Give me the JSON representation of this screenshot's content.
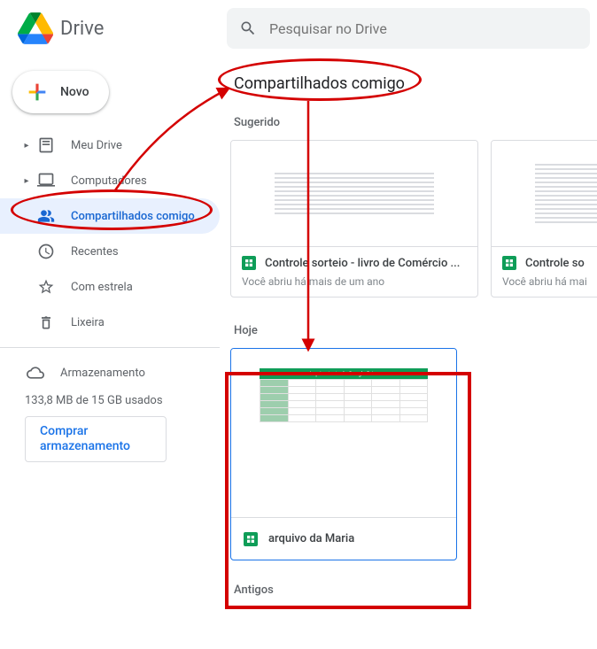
{
  "header": {
    "app_name": "Drive",
    "search_placeholder": "Pesquisar no Drive"
  },
  "sidebar": {
    "new_label": "Novo",
    "items": [
      {
        "label": "Meu Drive",
        "icon": "my-drive",
        "has_caret": true
      },
      {
        "label": "Computadores",
        "icon": "computers",
        "has_caret": true
      },
      {
        "label": "Compartilhados comigo",
        "icon": "shared",
        "active": true
      },
      {
        "label": "Recentes",
        "icon": "recent"
      },
      {
        "label": "Com estrela",
        "icon": "starred"
      },
      {
        "label": "Lixeira",
        "icon": "trash"
      }
    ],
    "storage_label": "Armazenamento",
    "storage_used": "133,8 MB de 15 GB usados",
    "buy_storage": "Comprar armazenamento"
  },
  "main": {
    "page_title": "Compartilhados comigo",
    "sections": {
      "suggested": "Sugerido",
      "today": "Hoje",
      "older": "Antigos"
    },
    "suggested_cards": [
      {
        "title": "Controle sorteio - livro de Comércio ...",
        "sub": "Você abriu há mais de um ano"
      },
      {
        "title": "Controle so",
        "sub": "Você abriu há mai"
      }
    ],
    "today_files": [
      {
        "title": "arquivo da Maria",
        "thumb_title": "Arquivo teste do Google Drive"
      }
    ]
  },
  "colors": {
    "accent": "#1a73e8",
    "annotation": "#d40000",
    "sheets_green": "#0f9d58"
  }
}
